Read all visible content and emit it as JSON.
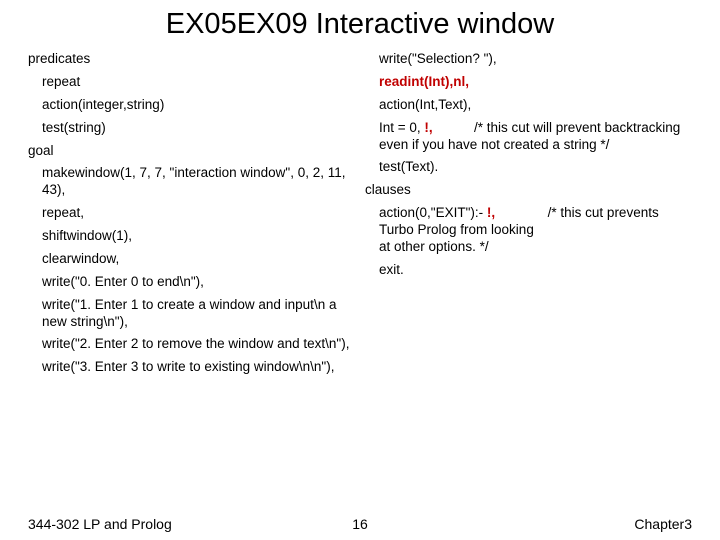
{
  "title": "EX05EX09 Interactive window",
  "left": {
    "l1": "predicates",
    "l2": "repeat",
    "l3": "action(integer,string)",
    "l4": "test(string)",
    "l5": "goal",
    "l6": "makewindow(1, 7, 7, \"interaction window\", 0, 2, 11, 43),",
    "l7": "repeat,",
    "l8": "shiftwindow(1),",
    "l9": "clearwindow,",
    "l10": "write(\"0. Enter 0 to end\\n\"),",
    "l11": "write(\"1. Enter 1 to create a window and input\\n   a new string\\n\"),",
    "l12": "write(\"2. Enter 2 to remove the window and text\\n\"),",
    "l13": "write(\"3. Enter 3 to write to existing window\\n\\n\"),"
  },
  "right": {
    "r1": "write(\"Selection? \"),",
    "r2": "readint(Int),nl,",
    "r3": "action(Int,Text),",
    "r4a": "Int = 0,",
    "r4b": "!,",
    "r4c": "/* this cut will prevent backtracking even if you have not created a string */",
    "r5": "test(Text).",
    "r6": "clauses",
    "r7a": "action(0,\"EXIT\"):-",
    "r7b": "!,",
    "r7c": "/* this cut prevents Turbo Prolog from looking",
    "r7d": "at other options. */",
    "r8": "exit."
  },
  "footer": {
    "left": "344-302 LP and Prolog",
    "center": "16",
    "right": "Chapter3"
  }
}
